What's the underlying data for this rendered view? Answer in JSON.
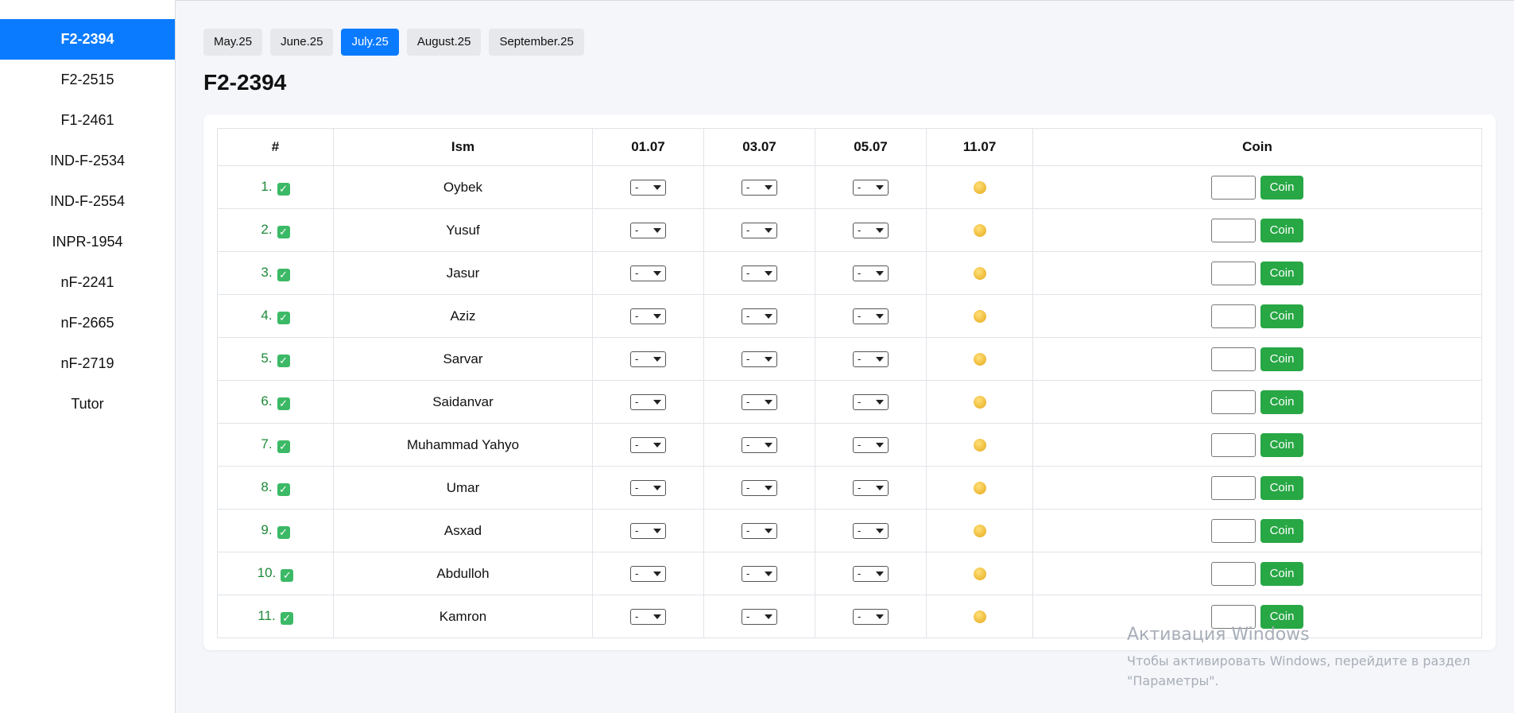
{
  "sidebar": {
    "items": [
      {
        "label": "F2-2394",
        "active": true
      },
      {
        "label": "F2-2515"
      },
      {
        "label": "F1-2461"
      },
      {
        "label": "IND-F-2534"
      },
      {
        "label": "IND-F-2554"
      },
      {
        "label": "INPR-1954"
      },
      {
        "label": "nF-2241"
      },
      {
        "label": "nF-2665"
      },
      {
        "label": "nF-2719"
      },
      {
        "label": "Tutor"
      }
    ]
  },
  "tabs": [
    {
      "label": "May.25"
    },
    {
      "label": "June.25"
    },
    {
      "label": "July.25",
      "active": true
    },
    {
      "label": "August.25"
    },
    {
      "label": "September.25"
    }
  ],
  "page_title": "F2-2394",
  "table": {
    "headers": [
      "#",
      "Ism",
      "01.07",
      "03.07",
      "05.07",
      "11.07",
      "Coin"
    ],
    "select_value": "-",
    "coin_button_label": "Coin",
    "rows": [
      {
        "num": "1.",
        "name": "Oybek"
      },
      {
        "num": "2.",
        "name": "Yusuf"
      },
      {
        "num": "3.",
        "name": "Jasur"
      },
      {
        "num": "4.",
        "name": "Aziz"
      },
      {
        "num": "5.",
        "name": "Sarvar"
      },
      {
        "num": "6.",
        "name": "Saidanvar"
      },
      {
        "num": "7.",
        "name": "Muhammad Yahyo"
      },
      {
        "num": "8.",
        "name": "Umar"
      },
      {
        "num": "9.",
        "name": "Asxad"
      },
      {
        "num": "10.",
        "name": "Abdulloh"
      },
      {
        "num": "11.",
        "name": "Kamron"
      }
    ]
  },
  "watermark": {
    "title": "Активация Windows",
    "subtitle": "Чтобы активировать Windows, перейдите в раздел \"Параметры\"."
  },
  "colors": {
    "accent": "#0a7bff",
    "success": "#28a745",
    "coin": "#e6a91a"
  },
  "icons": {
    "check": "check-box-icon",
    "coin": "coin-icon",
    "dropdown": "chevron-down-icon"
  }
}
